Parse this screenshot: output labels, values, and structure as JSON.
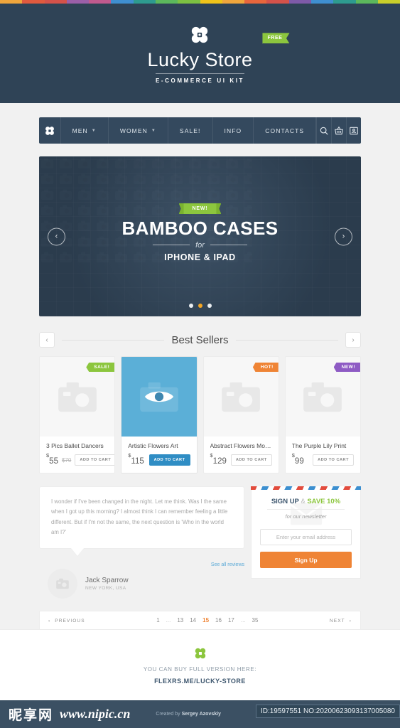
{
  "top_stripe_colors": [
    "#f0a63c",
    "#e05a3e",
    "#d4524a",
    "#9b5fa8",
    "#c05a8e",
    "#3f8fd0",
    "#2e9b8f",
    "#5cb85c",
    "#7cc142",
    "#f0c419",
    "#f0a63c",
    "#e8663c",
    "#d4524a",
    "#7e5aa8",
    "#3f8fd0",
    "#2e9b8f",
    "#5cb85c",
    "#c9cf2a"
  ],
  "header": {
    "brand": "Lucky Store",
    "tagline": "E-COMMERCE UI KIT",
    "flag": "FREE",
    "logo_icon": "clover-icon",
    "bg_color": "#2f4356"
  },
  "nav": {
    "logo_icon": "clover-icon",
    "items": [
      {
        "label": "MEN",
        "has_caret": true
      },
      {
        "label": "WOMEN",
        "has_caret": true
      },
      {
        "label": "SALE!",
        "has_caret": false
      },
      {
        "label": "INFO",
        "has_caret": false
      },
      {
        "label": "CONTACTS",
        "has_caret": false
      }
    ],
    "icons": [
      "search-icon",
      "basket-icon",
      "card-icon"
    ],
    "bg_color": "#34495e"
  },
  "hero": {
    "badge": "NEW!",
    "title": "BAMBOO CASES",
    "connector": "for",
    "subtitle": "IPHONE & IPAD",
    "prev_icon": "chevron-left-icon",
    "next_icon": "chevron-right-icon",
    "dots": [
      {
        "active": false
      },
      {
        "active": true
      },
      {
        "active": false
      }
    ],
    "active_dot_color": "#f5a623"
  },
  "best_sellers": {
    "title": "Best Sellers",
    "prev_label": "‹",
    "next_label": "›",
    "products": [
      {
        "name": "3 Pics Ballet Dancers",
        "price": "55",
        "currency": "$",
        "old_price": "$70",
        "badge": {
          "text": "SALE!",
          "type": "sale",
          "color": "#8cc63e"
        },
        "cta": "ADD TO CART",
        "featured": false,
        "image_icon": "camera-placeholder-icon"
      },
      {
        "name": "Artistic Flowers Art",
        "price": "115",
        "currency": "$",
        "old_price": "",
        "badge": null,
        "cta": "ADD TO CART",
        "featured": true,
        "image_icon": "eye-icon"
      },
      {
        "name": "Abstract Flowers Moder...",
        "price": "129",
        "currency": "$",
        "old_price": "",
        "badge": {
          "text": "HOT!",
          "type": "hot",
          "color": "#ef8435"
        },
        "cta": "ADD TO CART",
        "featured": false,
        "image_icon": "camera-placeholder-icon"
      },
      {
        "name": "The Purple Lily Print",
        "price": "99",
        "currency": "$",
        "old_price": "",
        "badge": {
          "text": "NEW!",
          "type": "new",
          "color": "#8e5bc4"
        },
        "cta": "ADD TO CART",
        "featured": false,
        "image_icon": "camera-placeholder-icon"
      }
    ]
  },
  "testimonial": {
    "quote": "I wonder if I've been changed in the night. Let me think. Was I the same when I got up this morning? I almost think I can remember feeling a little different. But if I'm not the same, the next question is 'Who in the world am I?'",
    "see_all": "See all reviews",
    "author_name": "Jack Sparrow",
    "author_location": "NEW YORK, USA",
    "avatar_icon": "camera-placeholder-icon"
  },
  "newsletter": {
    "title_a": "SIGN UP",
    "title_amp": "&",
    "title_b": "SAVE 10%",
    "subtitle": "for our newsletter",
    "input_value": "",
    "input_placeholder": "Enter your email address",
    "button": "Sign Up",
    "button_color": "#ef8435"
  },
  "pagination": {
    "previous": "PREVIOUS",
    "next": "NEXT",
    "prev_icon": "chevron-left-icon",
    "next_icon": "chevron-right-icon",
    "pages": [
      {
        "label": "1",
        "active": false,
        "dots": false
      },
      {
        "label": "...",
        "active": false,
        "dots": true
      },
      {
        "label": "13",
        "active": false,
        "dots": false
      },
      {
        "label": "14",
        "active": false,
        "dots": false
      },
      {
        "label": "15",
        "active": true,
        "dots": false
      },
      {
        "label": "16",
        "active": false,
        "dots": false
      },
      {
        "label": "17",
        "active": false,
        "dots": false
      },
      {
        "label": "...",
        "active": false,
        "dots": true
      },
      {
        "label": "35",
        "active": false,
        "dots": false
      }
    ],
    "active_color": "#ef8435"
  },
  "footer": {
    "logo_icon": "clover-icon",
    "line1": "YOU CAN BUY FULL VERSION HERE:",
    "line2": "FLEXRS.ME/LUCKY-STORE"
  },
  "watermark": {
    "cn_text": "昵享网",
    "url": "www.nipic.cn",
    "credit_prefix": "Created by ",
    "credit_name": "Sergey Azovskiy",
    "id_text": "ID:19597551 NO:20200623093137005080"
  }
}
